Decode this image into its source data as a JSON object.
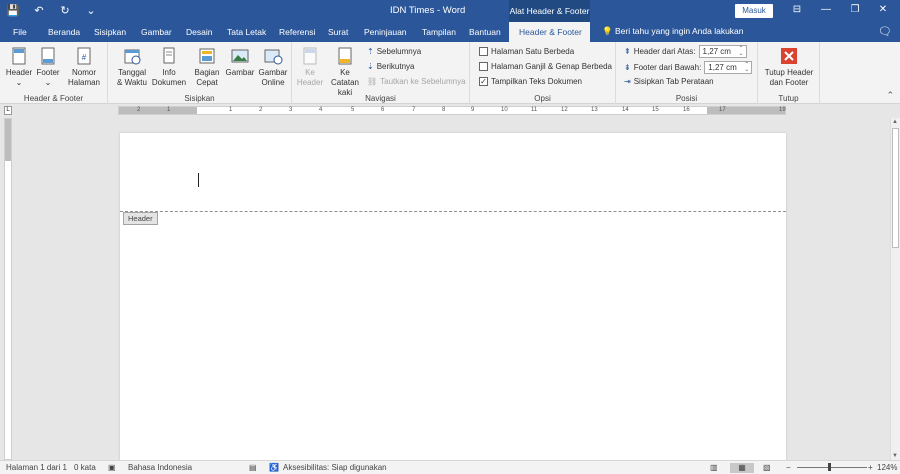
{
  "titlebar": {
    "doc_title": "IDN Times  -  Word",
    "context_title": "Alat Header & Footer",
    "signin": "Masuk",
    "qat": {
      "save_icon": "💾",
      "undo_icon": "↶",
      "redo_icon": "↻",
      "more_icon": "⌄"
    },
    "window": {
      "ribbon_options_icon": "⊟",
      "minimize_icon": "—",
      "restore_icon": "❐",
      "close_icon": "✕"
    }
  },
  "tabs": [
    {
      "label": "File"
    },
    {
      "label": "Beranda"
    },
    {
      "label": "Sisipkan"
    },
    {
      "label": "Gambar"
    },
    {
      "label": "Desain"
    },
    {
      "label": "Tata Letak"
    },
    {
      "label": "Referensi"
    },
    {
      "label": "Surat"
    },
    {
      "label": "Peninjauan"
    },
    {
      "label": "Tampilan"
    },
    {
      "label": "Bantuan"
    },
    {
      "label": "Header & Footer"
    }
  ],
  "tellme": "Beri tahu yang ingin Anda lakukan",
  "tellme_icon": "💡",
  "share_icon": "🗨",
  "ribbon": {
    "hf": {
      "label": "Header & Footer",
      "header": "Header",
      "footer": "Footer",
      "page_number_1": "Nomor",
      "page_number_2": "Halaman"
    },
    "insert": {
      "label": "Sisipkan",
      "datetime_1": "Tanggal",
      "datetime_2": "& Waktu",
      "docinfo_1": "Info",
      "docinfo_2": "Dokumen",
      "quickparts_1": "Bagian",
      "quickparts_2": "Cepat",
      "pictures": "Gambar",
      "online_1": "Gambar",
      "online_2": "Online"
    },
    "nav": {
      "label": "Navigasi",
      "goto_header_1": "Ke",
      "goto_header_2": "Header",
      "goto_footer_1": "Ke Catatan",
      "goto_footer_2": "kaki",
      "previous": "Sebelumnya",
      "next": "Berikutnya",
      "link_prev": "Tautkan ke Sebelumnya"
    },
    "options": {
      "label": "Opsi",
      "diff_first": "Halaman Satu Berbeda",
      "diff_odd_even": "Halaman Ganjil & Genap Berbeda",
      "show_doc_text": "Tampilkan Teks Dokumen"
    },
    "position": {
      "label": "Posisi",
      "header_top_label": "Header dari Atas:",
      "header_top_value": "1,27 cm",
      "footer_bottom_label": "Footer dari Bawah:",
      "footer_bottom_value": "1,27 cm",
      "align_tab": "Sisipkan Tab Perataan"
    },
    "close": {
      "label": "Tutup",
      "btn_1": "Tutup Header",
      "btn_2": "dan Footer"
    }
  },
  "ruler_numbers": [
    "2",
    "1",
    "1",
    "2",
    "3",
    "4",
    "5",
    "6",
    "7",
    "8",
    "9",
    "10",
    "11",
    "12",
    "13",
    "14",
    "15",
    "16",
    "17",
    "19"
  ],
  "document": {
    "header_tag": "Header"
  },
  "status": {
    "page": "Halaman 1 dari 1",
    "words": "0 kata",
    "language": "Bahasa Indonesia",
    "accessibility": "Aksesibilitas: Siap digunakan",
    "zoom": "124%",
    "zoom_minus": "−",
    "zoom_plus": "+"
  },
  "colors": {
    "accent": "#2b579a",
    "close_red": "#d9432f"
  }
}
